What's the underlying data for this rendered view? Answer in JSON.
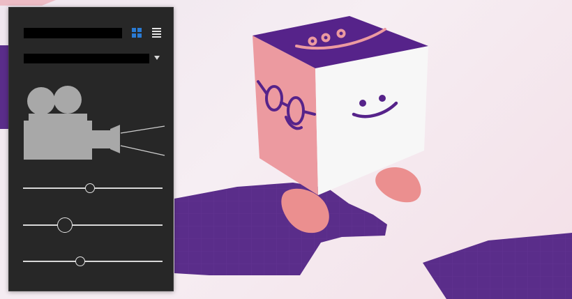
{
  "panel": {
    "name_value": "",
    "preset_value": "",
    "sliders": [
      {
        "value": 0.48
      },
      {
        "value": 0.3
      },
      {
        "value": 0.41
      }
    ]
  },
  "colors": {
    "panel_bg": "#272727",
    "accent_blue": "#2a7bd4",
    "shadow_purple": "#5a2d8a",
    "cube_top": "#56238a",
    "cube_side_pink": "#ec9aa0",
    "cube_front": "#f7f7f7",
    "feet_pink": "#eb8f8f"
  },
  "icons": [
    "grid-view-icon",
    "list-view-icon",
    "movie-camera-icon",
    "chevron-down-icon"
  ]
}
